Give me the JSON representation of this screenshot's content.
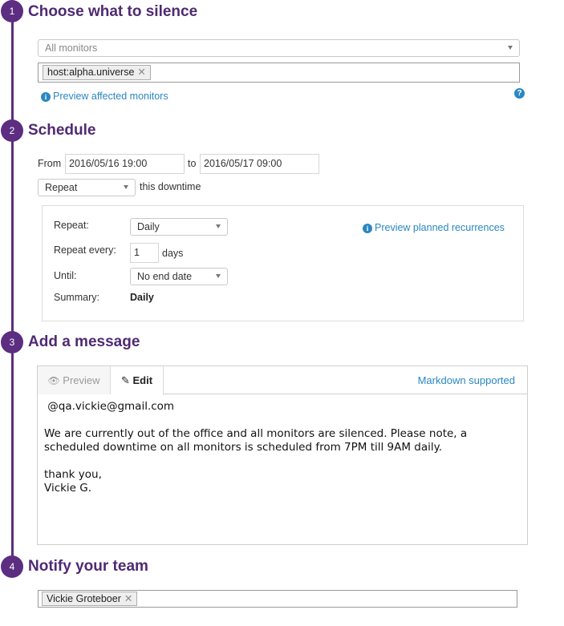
{
  "steps": [
    {
      "num": "1",
      "title": "Choose what to silence"
    },
    {
      "num": "2",
      "title": "Schedule"
    },
    {
      "num": "3",
      "title": "Add a message"
    },
    {
      "num": "4",
      "title": "Notify your team"
    }
  ],
  "silence": {
    "monitor_select": "All monitors",
    "scope_tags": [
      "host:alpha.universe"
    ],
    "preview_link": "Preview affected monitors"
  },
  "schedule": {
    "from_label": "From",
    "from_value": "2016/05/16 19:00",
    "to_label": "to",
    "to_value": "2016/05/17 09:00",
    "mode_select": "Repeat",
    "mode_suffix": "this downtime",
    "recurrence": {
      "repeat_label": "Repeat:",
      "repeat_value": "Daily",
      "every_label": "Repeat every:",
      "every_value": "1",
      "every_unit": "days",
      "until_label": "Until:",
      "until_value": "No end date",
      "summary_label": "Summary:",
      "summary_value": "Daily",
      "preview_link": "Preview planned recurrences"
    }
  },
  "message": {
    "tab_preview": "Preview",
    "tab_edit": "Edit",
    "markdown_note": "Markdown supported",
    "body": " @qa.vickie@gmail.com\n\nWe are currently out of the office and all monitors are silenced. Please note, a\nscheduled downtime on all monitors is scheduled from 7PM till 9AM daily.\n\nthank you,\nVickie G."
  },
  "notify": {
    "recipients": [
      "Vickie Groteboer"
    ]
  },
  "colors": {
    "accent_purple": "#5c2d80",
    "title_purple": "#4f2a72",
    "link_blue": "#2a87c2"
  },
  "icons": {
    "info": "info-circle-icon",
    "help": "question-circle-icon",
    "preview": "eye-icon",
    "edit": "pencil-square-icon",
    "remove": "close-icon",
    "dropdown": "caret-down-icon"
  }
}
